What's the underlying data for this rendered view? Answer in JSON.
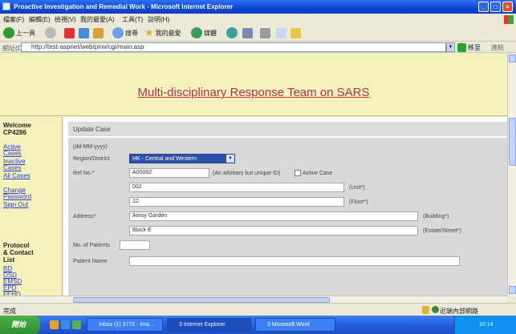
{
  "window": {
    "title": "Proactive Investigation and Remedial Work - Microsoft Internet Explorer"
  },
  "menu": [
    "檔案(F)",
    "編輯(E)",
    "檢視(V)",
    "我的最愛(A)",
    "工具(T)",
    "說明(H)"
  ],
  "toolbar": {
    "back_label": "上一頁",
    "search_label": "搜尋",
    "favorites_label": "我的最愛",
    "media_label": "媒體"
  },
  "address": {
    "label": "網址(D)",
    "url": "http://test-aspnet/web/pirw/cgi/main.asp",
    "go_label": "移至",
    "links_label": "連結"
  },
  "banner": {
    "title": "Multi-disciplinary Response Team on SARS"
  },
  "sidebar": {
    "welcome": "Welcome",
    "user": "CP4286",
    "links": [
      {
        "label": "Active"
      },
      {
        "label": "Cases"
      },
      {
        "label": "Inactive"
      },
      {
        "label": "Cases"
      },
      {
        "label": "All Cases"
      }
    ],
    "change_password": [
      "Change",
      "Password"
    ],
    "signout": "Sign Out",
    "protocol": [
      "Protocol",
      "& Contact",
      "List"
    ],
    "protocol_links": [
      "BD",
      "DSD",
      "EMSD",
      "EPD",
      "FEHD"
    ]
  },
  "form": {
    "header": "Update Case",
    "date_hint": "(dd-MM-yyyy)",
    "region_label": "Region/District",
    "region_value": "HK - Central and Western",
    "ref_label": "Ref No.*",
    "ref_value": "A00002",
    "ref_hint": "(An arbitrary but unique ID)",
    "active_label": "Active Case",
    "address_label": "Address*",
    "address_rows": [
      {
        "value": "002",
        "suffix": "(Unit*)"
      },
      {
        "value": "22",
        "suffix": "(Floor*)"
      },
      {
        "value": "Amoy Garden",
        "suffix": "(Building*)"
      },
      {
        "value": "Block E",
        "suffix": "(Estate/Street*)"
      }
    ],
    "patients_label": "No. of Patients",
    "patients_value": "",
    "patient_name_label": "Patient Name",
    "patient_name_value": ""
  },
  "status": {
    "left": "完成",
    "right": "近端內部網路"
  },
  "taskbar": {
    "start": "開始",
    "tasks": [
      "Inbox (1) 3772 - Ima...",
      "3 Internet Explorer",
      "3 Microsoft Word"
    ],
    "clock": "10:14"
  }
}
